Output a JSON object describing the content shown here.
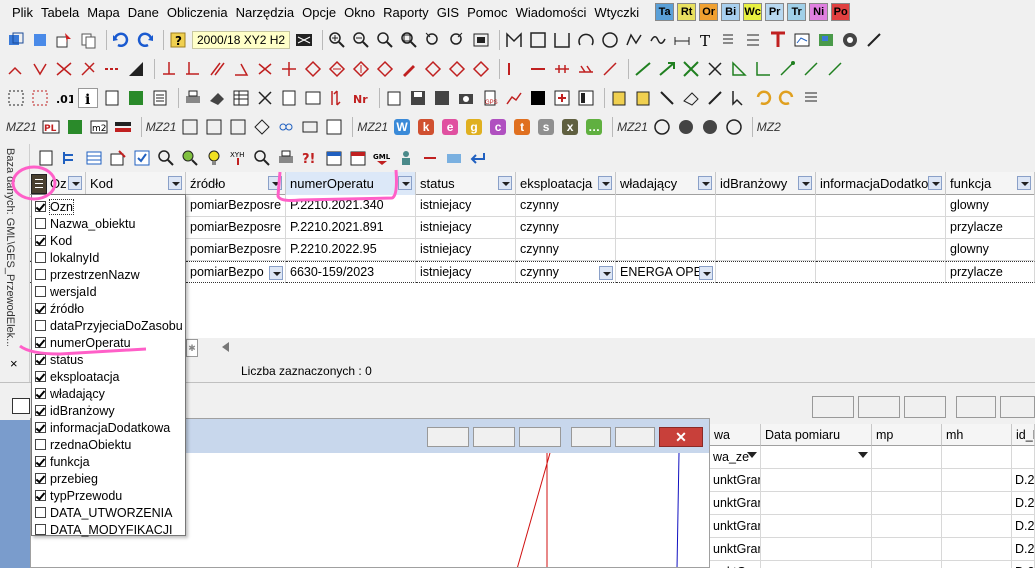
{
  "menu": [
    "Plik",
    "Tabela",
    "Mapa",
    "Dane",
    "Obliczenia",
    "Narzędzia",
    "Opcje",
    "Okno",
    "Raporty",
    "GIS",
    "Pomoc",
    "Wiadomości",
    "Wtyczki"
  ],
  "menu_badges": [
    {
      "label": "Ta",
      "color": "#5aa0d8"
    },
    {
      "label": "Rt",
      "color": "#e8e060"
    },
    {
      "label": "Or",
      "color": "#f0a030"
    },
    {
      "label": "Bi",
      "color": "#a8d0f0"
    },
    {
      "label": "Wc",
      "color": "#e8f040"
    },
    {
      "label": "Pr",
      "color": "#b8d8f0"
    },
    {
      "label": "Tr",
      "color": "#a0d0e8"
    },
    {
      "label": "Ni",
      "color": "#e080e0"
    },
    {
      "label": "Po",
      "color": "#e04040"
    }
  ],
  "toolbar": {
    "scale_label": "2000/18 XY2 H2",
    "mz_labels": [
      "MZ21",
      "MZ21",
      "MZ21",
      "MZ21",
      "MZ2"
    ],
    "letter_icons": [
      {
        "label": "W",
        "color": "#3a8ad8"
      },
      {
        "label": "k",
        "color": "#d05030"
      },
      {
        "label": "e",
        "color": "#e050a0"
      },
      {
        "label": "g",
        "color": "#e0b020"
      },
      {
        "label": "c",
        "color": "#b050c0"
      },
      {
        "label": "t",
        "color": "#e07020"
      },
      {
        "label": "s",
        "color": "#909090"
      },
      {
        "label": "x",
        "color": "#606040"
      },
      {
        "label": "…",
        "color": "#60b040"
      }
    ]
  },
  "side_panel": {
    "title": "Baza danych: GML\\GES_PrzewodElek...",
    "close_label": "×"
  },
  "table": {
    "columns": [
      "Oz",
      "Kod",
      "źródło",
      "numerOperatu",
      "status",
      "eksploatacja",
      "władający",
      "idBranżowy",
      "informacjaDodatko",
      "funkcja"
    ],
    "rows": [
      [
        "",
        "",
        "pomiarBezposre",
        "P.2210.2021.340",
        "istniejacy",
        "czynny",
        "",
        "",
        "",
        "glowny"
      ],
      [
        "",
        "",
        "pomiarBezposre",
        "P.2210.2021.891",
        "istniejacy",
        "czynny",
        "",
        "",
        "",
        "przylacze"
      ],
      [
        "",
        "",
        "pomiarBezposre",
        "P.2210.2022.95",
        "istniejacy",
        "czynny",
        "",
        "",
        "",
        "glowny"
      ],
      [
        "",
        "",
        "pomiarBezpo",
        "6630-159/2023",
        "istniejacy",
        "czynny",
        "ENERGA OPE",
        "",
        "",
        "przylacze"
      ]
    ],
    "selection_label": "Liczba zaznaczonych : 0"
  },
  "column_chooser": {
    "items": [
      {
        "label": "Ozn",
        "checked": true
      },
      {
        "label": "Nazwa_obiektu",
        "checked": false
      },
      {
        "label": "Kod",
        "checked": true
      },
      {
        "label": "lokalnyId",
        "checked": false
      },
      {
        "label": "przestrzenNazw",
        "checked": false
      },
      {
        "label": "wersjaId",
        "checked": false
      },
      {
        "label": "źródło",
        "checked": true
      },
      {
        "label": "dataPrzyjeciaDoZasobu",
        "checked": false
      },
      {
        "label": "numerOperatu",
        "checked": true
      },
      {
        "label": "status",
        "checked": true
      },
      {
        "label": "eksploatacja",
        "checked": true
      },
      {
        "label": "władający",
        "checked": true
      },
      {
        "label": "idBranżowy",
        "checked": true
      },
      {
        "label": "informacjaDodatkowa",
        "checked": true
      },
      {
        "label": "rzednaObiektu",
        "checked": false
      },
      {
        "label": "funkcja",
        "checked": true
      },
      {
        "label": "przebieg",
        "checked": true
      },
      {
        "label": "typPrzewodu",
        "checked": true
      },
      {
        "label": "DATA_UTWORZENIA",
        "checked": false
      },
      {
        "label": "DATA_MODYFIKACJI",
        "checked": false
      }
    ]
  },
  "lower_grid": {
    "columns": [
      "wa",
      "Data pomiaru",
      "mp",
      "mh",
      "id_P"
    ],
    "filter_value": "wa_ze",
    "rows": [
      [
        "unktGrar",
        "D.2"
      ],
      [
        "unktGrar",
        "D.2"
      ],
      [
        "unktGrar",
        "D.2"
      ],
      [
        "unktGrar",
        "D.2"
      ],
      [
        "unktGrar",
        "D.2"
      ]
    ]
  },
  "inner_window": {
    "close_label": "✕"
  },
  "colors": {
    "annotation": "#ff5fc8",
    "selection_blue": "#dce8f8",
    "window_title": "#c8d7ec"
  }
}
